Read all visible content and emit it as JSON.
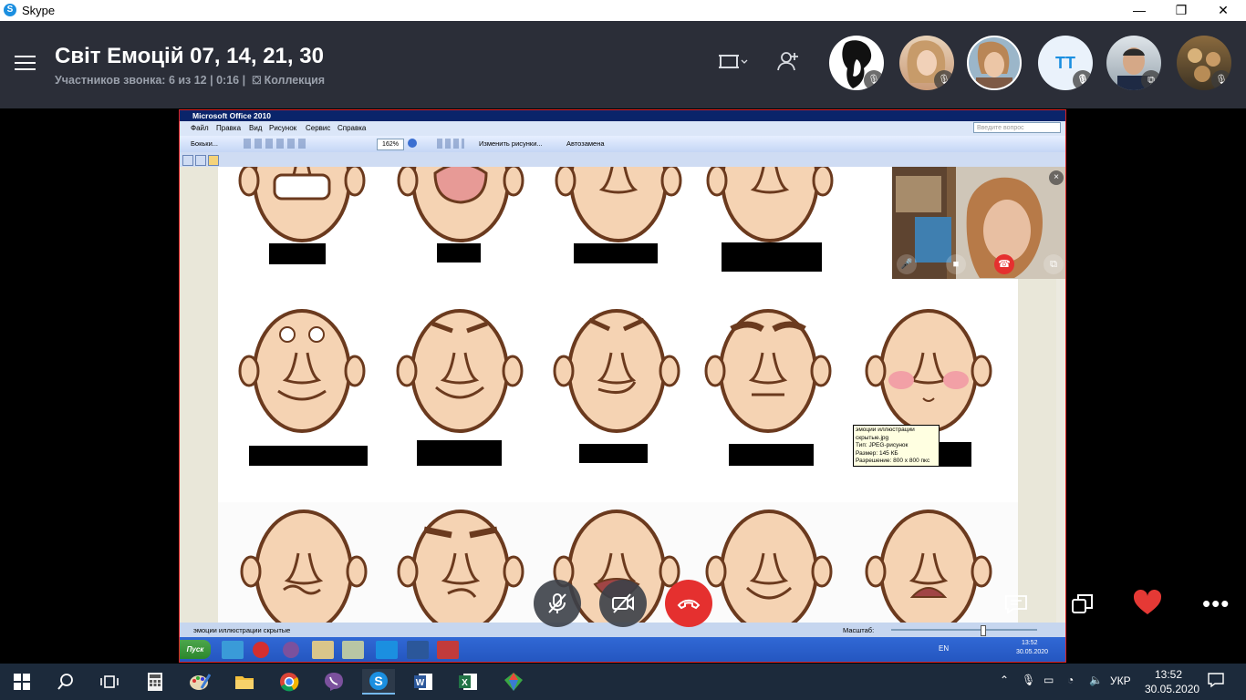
{
  "window": {
    "app_name": "Skype",
    "minimize": "—",
    "maximize": "❐",
    "close": "✕"
  },
  "call": {
    "title": "Світ Емоцій 07, 14, 21, 30",
    "participants_info": "Участников звонка: 6 из 12 | 0:16 |",
    "collection_label": "Коллекция",
    "avatar_initials": "TT"
  },
  "shared_screen": {
    "office_title": "Microsoft Office 2010",
    "menu": [
      "Файл",
      "Правка",
      "Вид",
      "Рисунок",
      "Сервис",
      "Справка"
    ],
    "help_placeholder": "Введите вопрос",
    "toolbar": {
      "glasses_label": "Бокьки...",
      "zoom_value": "162%",
      "edit_picture_label": "Изменить рисунки...",
      "autocorrect_label": "Автозамена"
    },
    "status_left": "эмоции иллюстрации скрытые",
    "status_zoom_label": "Масштаб:",
    "tooltip": [
      "эмоции иллюстрации",
      "скрытые.jpg",
      "Тип: JPEG-рисунок",
      "Размер: 145 КБ",
      "Разрешение: 800 x 800 пкс"
    ],
    "xp_start_label": "Пуск",
    "xp_lang": "EN",
    "xp_time": "13:52",
    "xp_date": "30.05.2020"
  },
  "taskbar": {
    "language": "УКР",
    "time": "13:52",
    "date": "30.05.2020"
  },
  "colors": {
    "header_bg": "#2b2e38",
    "end_call": "#e5302f",
    "heart": "#e53935",
    "skype_blue": "#1b8fe0"
  }
}
